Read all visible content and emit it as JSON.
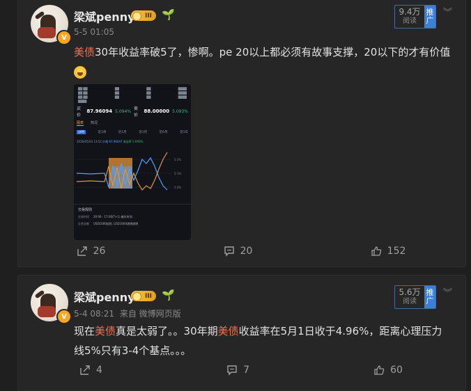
{
  "posts": [
    {
      "username": "梁斌penny",
      "level_badge": "III",
      "timestamp": "5-5 01:05",
      "source": "",
      "views": "9.4万",
      "views_label": "阅读",
      "push_label": "推广",
      "text_parts": [
        {
          "text": "美债",
          "highlight": true
        },
        {
          "text": "30年收益率破5了，惨啊。pe 20以上都必须有故事支撑，20以下的才有价值",
          "highlight": false
        }
      ],
      "has_emoji": true,
      "counts": {
        "share": "26",
        "comment": "20",
        "like": "152"
      }
    },
    {
      "username": "梁斌penny",
      "level_badge": "III",
      "timestamp": "5-4 08:21",
      "source": "来自 微博网页版",
      "views": "5.6万",
      "views_label": "阅读",
      "push_label": "推广",
      "text_parts": [
        {
          "text": "现在",
          "highlight": false
        },
        {
          "text": "美债",
          "highlight": true
        },
        {
          "text": "真是太弱了。。30年期",
          "highlight": false
        },
        {
          "text": "美债",
          "highlight": true
        },
        {
          "text": "收益率在5月1日收于4.96%，距离心理压力线5%只有3-4个基点。。。",
          "highlight": false
        }
      ],
      "has_emoji": false,
      "counts": {
        "share": "4",
        "comment": "7",
        "like": "60"
      }
    }
  ],
  "thumbnail": {
    "quote_buy_label": "买价",
    "quote_buy": "87.96094",
    "quote_buy_pct": "5.094%",
    "quote_sell_label": "卖价",
    "quote_sell": "88.00000",
    "quote_sell_pct": "5.093%",
    "tab_chart": "图表",
    "tab_info": "简况",
    "periods": [
      "分时",
      "近1周",
      "近1月",
      "近3月",
      "近6月",
      "近1年"
    ],
    "legend_date": "2026/05/04 13:52",
    "legend_price_label": "价格",
    "legend_price": "87.96047",
    "legend_yield_label": "收益率",
    "legend_yield": "5.093%",
    "rules_title": "交易规则",
    "rule_rows": [
      {
        "k": "交易时间",
        "v": "20:00 - 17:00(T+1) 美东时间"
      },
      {
        "k": "交易金额",
        "v": "USD1000起投, USD1000递增递增"
      }
    ],
    "colors": {
      "price": "#4da3ff",
      "yield": "#e5943a"
    }
  },
  "colors": {
    "highlight": "#eb7350",
    "accent": "#3d7fd6",
    "background": "#1f1f1f",
    "card": "#262626"
  }
}
